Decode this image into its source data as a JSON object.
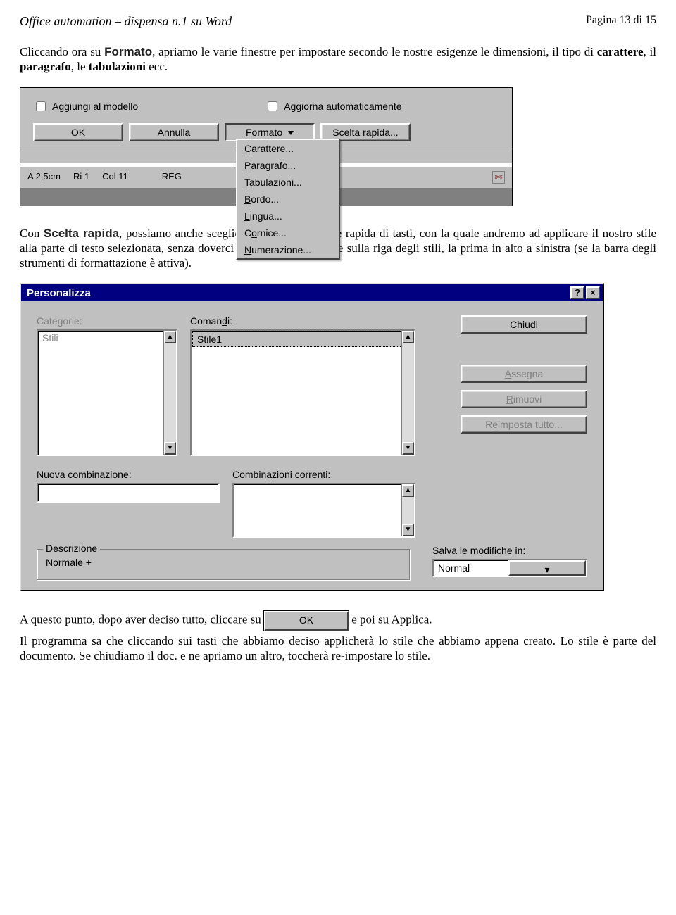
{
  "header": {
    "title": "Office automation – dispensa n.1 su Word",
    "page": "Pagina 13 di 15"
  },
  "para1": {
    "pre": "Cliccando ora su ",
    "kw1": "Formato",
    "mid1": ", apriamo le varie finestre per impostare secondo le nostre esigenze le dimensioni, il tipo di ",
    "b1": "carattere",
    "mid2": ", il ",
    "b2": "paragrafo",
    "mid3": ", le ",
    "b3": "tabulazioni",
    "end": " ecc."
  },
  "shot1": {
    "cb1": "Aggiungi al modello",
    "cb2": "Aggiorna automaticamente",
    "btn_ok": "OK",
    "btn_annulla": "Annulla",
    "btn_formato": "Formato",
    "btn_scelta": "Scelta rapida...",
    "menu": [
      "Carattere...",
      "Paragrafo...",
      "Tabulazioni...",
      "Bordo...",
      "Lingua...",
      "Cornice...",
      "Numerazione..."
    ],
    "status_a": "A 2,5cm",
    "status_ri": "Ri 1",
    "status_col": "Col 11",
    "status_reg": "REG"
  },
  "para2": {
    "pre": "Con ",
    "kw": "Scelta rapida",
    "rest": ", possiamo anche scegliere una combinazione rapida di tasti, con la quale andremo ad applicare il nostro stile alla parte di testo selezionata, senza doverci spostare con il mouse sulla riga degli stili, la prima in alto a sinistra (se la barra degli strumenti di formattazione è attiva)."
  },
  "shot2": {
    "title": "Personalizza",
    "lbl_categorie": "Categorie:",
    "lbl_comandi": "Comandi:",
    "item_stili": "Stili",
    "item_stile1": "Stile1",
    "btn_chiudi": "Chiudi",
    "btn_assegna": "Assegna",
    "btn_rimuovi": "Rimuovi",
    "btn_reimposta": "Reimposta tutto...",
    "lbl_nuova": "Nuova combinazione:",
    "lbl_correnti": "Combinazioni correnti:",
    "lbl_descr": "Descrizione",
    "descr_val": "Normale +",
    "lbl_salva": "Salva le modifiche in:",
    "combo_val": "Normal"
  },
  "para3": {
    "pre": "A questo punto, dopo aver deciso tutto, cliccare su ",
    "ok": "OK",
    "post": " e poi su Applica."
  },
  "para4": "Il programma sa che cliccando sui tasti che abbiamo deciso applicherà lo stile che abbiamo appena creato. Lo stile è parte del documento. Se chiudiamo il doc. e ne apriamo un altro, toccherà re-impostare lo stile."
}
